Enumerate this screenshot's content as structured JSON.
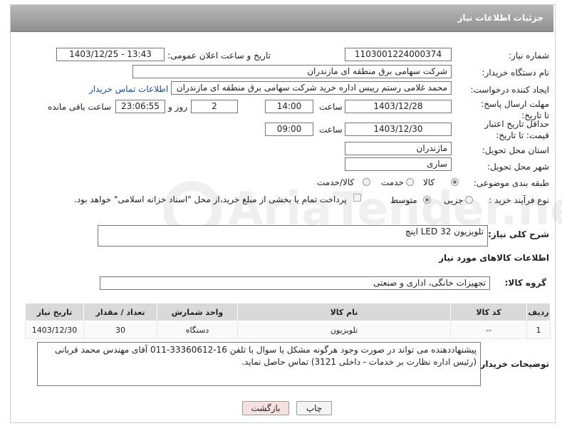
{
  "header": {
    "title": "جزئیات اطلاعات نیاز"
  },
  "fields": {
    "need_number_label": "شماره نیاز:",
    "need_number": "1103001224000374",
    "announce_label": "تاریخ و ساعت اعلان عمومی:",
    "announce_value": "1403/12/25 - 13:43",
    "buyer_label": "نام دستگاه خریدار:",
    "buyer_value": "شرکت سهامی برق منطقه ای مازندران",
    "creator_label": "ایجاد کننده درخواست:",
    "creator_value": "محمد غلامی رستم رییس اداره خرید شرکت سهامی برق منطقه ای مازندران",
    "contact_link": "اطلاعات تماس خریدار",
    "deadline_label": "مهلت ارسال پاسخ: تا تاریخ:",
    "deadline_date": "1403/12/28",
    "time_label": "ساعت",
    "deadline_time": "14:00",
    "days_value": "2",
    "days_label": "روز و",
    "remaining_value": "23:06:55",
    "remaining_label": "ساعت باقی مانده",
    "validity_label": "حداقل تاریخ اعتبار قیمت: تا تاریخ:",
    "validity_date": "1403/12/30",
    "validity_time": "09:00",
    "province_label": "استان محل تحویل:",
    "province_value": "مازندران",
    "city_label": "شهر محل تحویل:",
    "city_value": "ساری",
    "category_label": "طبقه بندی موضوعی:",
    "category_options": [
      "کالا",
      "خدمت",
      "کالا/خدمت"
    ],
    "process_label": "نوع فرآیند خرید :",
    "process_options": [
      "جزیی",
      "متوسط"
    ],
    "payment_note": "پرداخت تمام یا بخشی از مبلغ خرید،از محل \"اسناد خزانه اسلامی\" خواهد بود.",
    "desc_label": "شرح کلی نیاز:",
    "desc_value": "تلویزیون 32   LED   اینچ",
    "goods_info_title": "اطلاعات کالاهای مورد نیاز",
    "goods_group_label": "گروه کالا:",
    "goods_group_value": "تجهیزات خانگی، اداری و صنعتی",
    "buyer_notes_label": "توضیحات خریدار:",
    "buyer_notes_value": "پیشنهاددهنده می تواند در صورت وجود هرگونه مشکل یا سوال با تلفن 16-33360612-011 آقای مهندس محمد قربانی (رئیس اداره نظارت بر خدمات - داخلی 3121) تماس حاصل نماید."
  },
  "table": {
    "headers": [
      "ردیف",
      "کد کالا",
      "نام کالا",
      "واحد شمارش",
      "تعداد / مقدار",
      "تاریخ نیاز"
    ],
    "rows": [
      [
        "1",
        "--",
        "تلویزیون",
        "دستگاه",
        "30",
        "1403/12/30"
      ]
    ]
  },
  "buttons": {
    "print": "چاپ",
    "back": "بازگشت"
  },
  "watermark": {
    "text": "AriaTender.neT"
  },
  "colors": {
    "header": "#9e9e9e",
    "link": "#1a4fa3",
    "back_button": "#f7e0e0"
  }
}
